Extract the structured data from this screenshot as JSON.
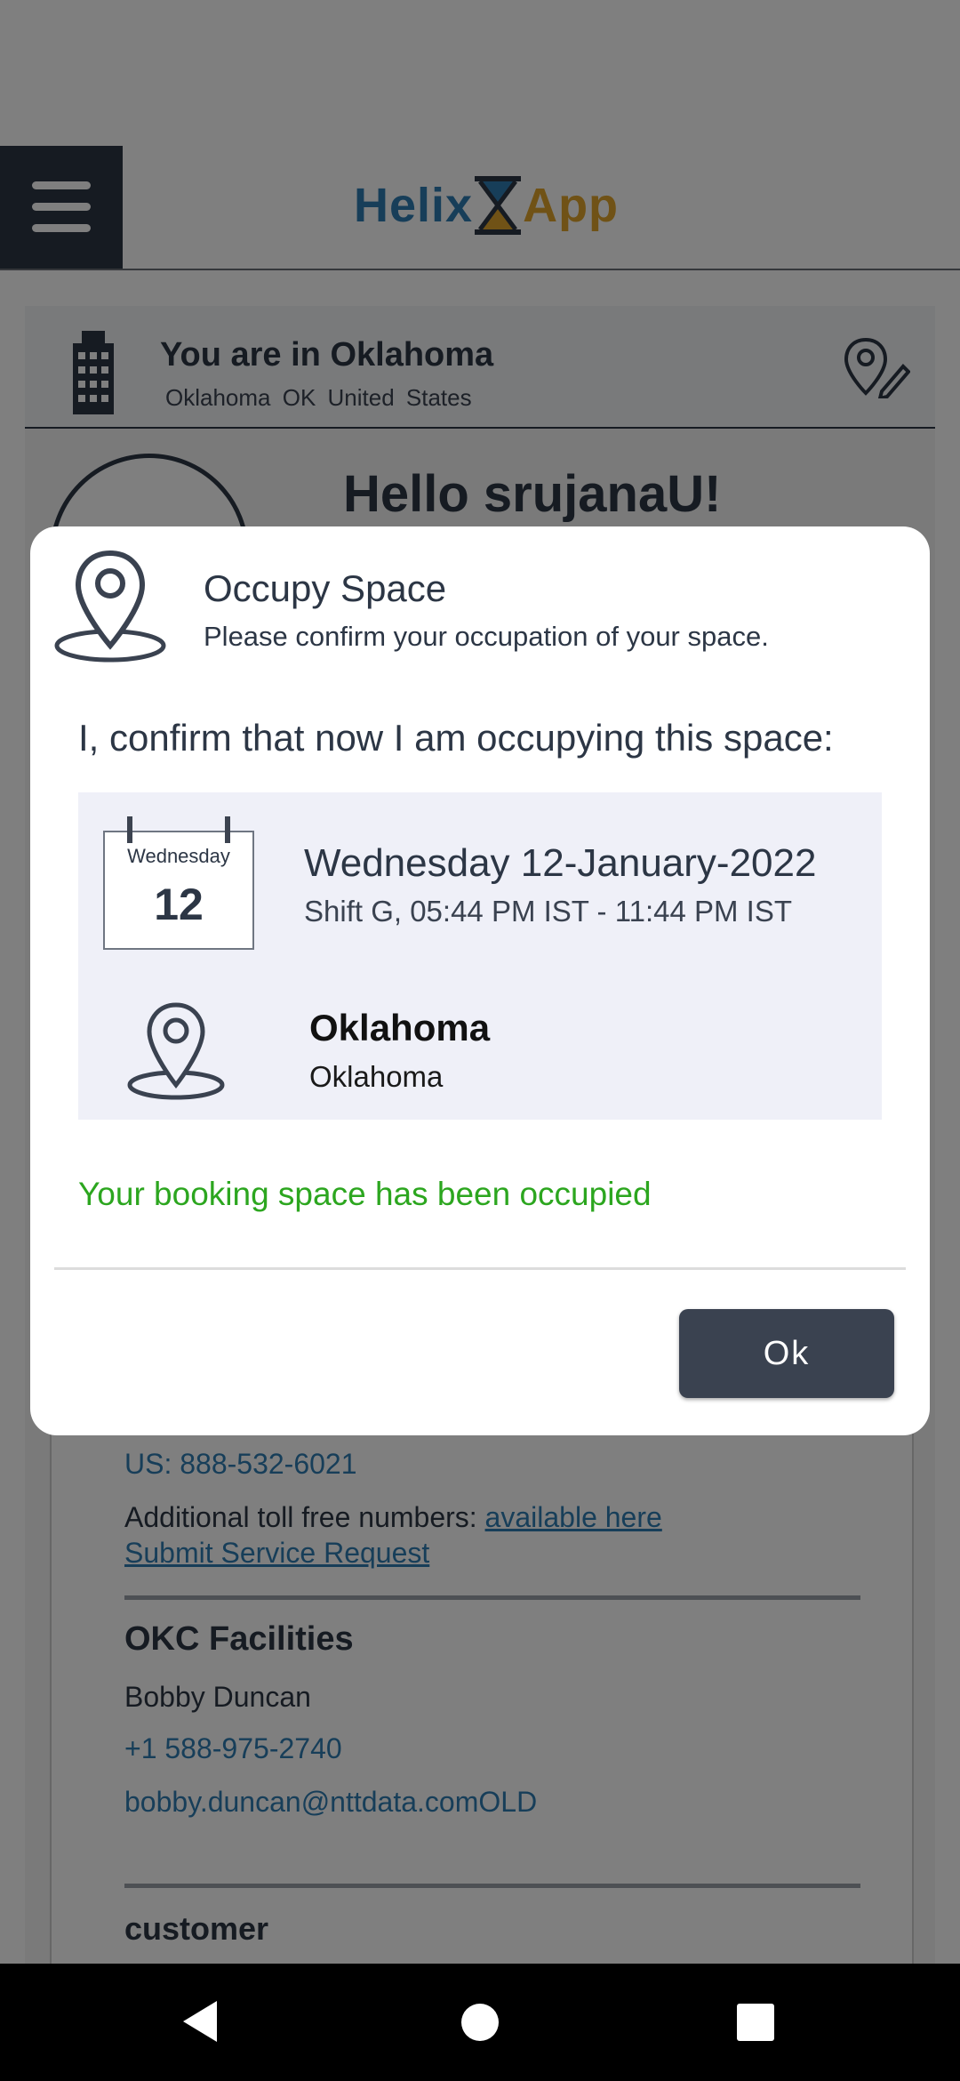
{
  "app": {
    "logo_left": "Helix",
    "logo_right": "App"
  },
  "location": {
    "title": "You are in Oklahoma",
    "subtitle": "Oklahoma   OK  United States"
  },
  "greeting": "Hello srujanaU!",
  "contacts": {
    "phone_us": "US: 888-532-6021",
    "toll_free_label": "Additional toll free numbers: ",
    "toll_free_link": "available here",
    "service_request": "Submit Service Request",
    "facilities_title": "OKC Facilities",
    "facilities_person": "Bobby Duncan",
    "facilities_phone": "+1 588-975-2740",
    "facilities_email": "bobby.duncan@nttdata.comOLD",
    "customer_title": "customer"
  },
  "dialog": {
    "title": "Occupy Space",
    "subtitle": "Please confirm your occupation of your space.",
    "confirm_text": "I, confirm that now I am occupying this space:",
    "calendar_day": "Wednesday",
    "calendar_date": "12",
    "date_line": "Wednesday 12-January-2022",
    "shift_line": "Shift G, 05:44 PM IST - 11:44 PM IST",
    "place_name": "Oklahoma",
    "place_sub": "Oklahoma",
    "success_message": "Your booking space has been occupied",
    "ok_label": "Ok"
  },
  "colors": {
    "success": "#2ca61f",
    "button": "#3a4250",
    "link": "#2f7db3"
  }
}
